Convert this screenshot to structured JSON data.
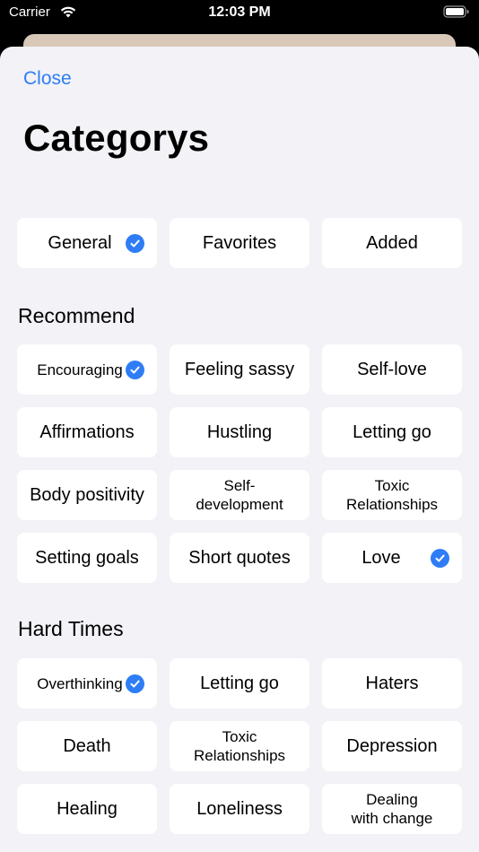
{
  "status": {
    "carrier": "Carrier",
    "time": "12:03 PM"
  },
  "header": {
    "close_label": "Close",
    "title": "Categorys"
  },
  "top_group": [
    {
      "label": "General",
      "checked": true
    },
    {
      "label": "Favorites",
      "checked": false
    },
    {
      "label": "Added",
      "checked": false
    }
  ],
  "recommend": {
    "title": "Recommend",
    "items": [
      {
        "label": "Encouraging",
        "checked": true
      },
      {
        "label": "Feeling sassy",
        "checked": false
      },
      {
        "label": "Self-love",
        "checked": false
      },
      {
        "label": "Affirmations",
        "checked": false
      },
      {
        "label": "Hustling",
        "checked": false
      },
      {
        "label": "Letting go",
        "checked": false
      },
      {
        "label": "Body positivity",
        "checked": false
      },
      {
        "label": "Self-\ndevelopment",
        "checked": false
      },
      {
        "label": "Toxic\nRelationships",
        "checked": false
      },
      {
        "label": "Setting goals",
        "checked": false
      },
      {
        "label": "Short quotes",
        "checked": false
      },
      {
        "label": "Love",
        "checked": true
      }
    ]
  },
  "hard_times": {
    "title": "Hard Times",
    "items": [
      {
        "label": "Overthinking",
        "checked": true
      },
      {
        "label": "Letting go",
        "checked": false
      },
      {
        "label": "Haters",
        "checked": false
      },
      {
        "label": "Death",
        "checked": false
      },
      {
        "label": "Toxic\nRelationships",
        "checked": false
      },
      {
        "label": "Depression",
        "checked": false
      },
      {
        "label": "Healing",
        "checked": false
      },
      {
        "label": "Loneliness",
        "checked": false
      },
      {
        "label": "Dealing\nwith change",
        "checked": false
      }
    ]
  },
  "colors": {
    "accent": "#2f7df6",
    "sheet_background": "#f2f2f7",
    "chip_background": "#ffffff"
  }
}
